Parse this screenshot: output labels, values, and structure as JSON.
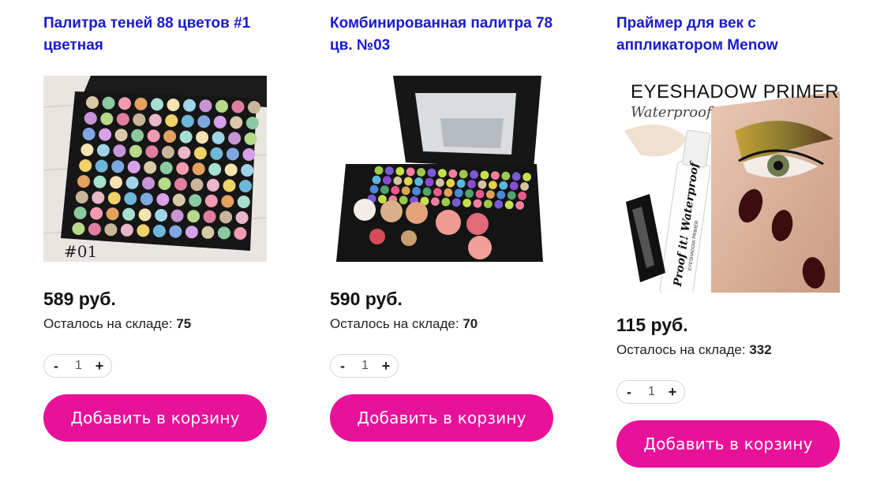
{
  "products": [
    {
      "title": "Палитра теней 88 цветов #1 цветная",
      "image_label": "#01",
      "price": "589 руб.",
      "stock_label": "Осталось на складе: ",
      "stock_value": "75",
      "qty_minus": "-",
      "qty_value": "1",
      "qty_plus": "+",
      "button_label": "Добавить в корзину"
    },
    {
      "title": "Комбинированная палитра 78 цв. №03",
      "price": "590 руб.",
      "stock_label": "Осталось на складе: ",
      "stock_value": "70",
      "qty_minus": "-",
      "qty_value": "1",
      "qty_plus": "+",
      "button_label": "Добавить в корзину"
    },
    {
      "title": "Праймер для век с аппликатором Menow",
      "image_heading": "EYESHADOW PRIMER",
      "image_subheading": "Waterproof",
      "image_tube_text": "Proof it! Waterproof",
      "image_tube_subtext": "EYESHADOW PRIMER",
      "price": "115 руб.",
      "stock_label": "Осталось на складе: ",
      "stock_value": "332",
      "qty_minus": "-",
      "qty_value": "1",
      "qty_plus": "+",
      "button_label": "Добавить в корзину"
    }
  ],
  "colors": {
    "title": "#1a1acc",
    "button": "#e8119a"
  }
}
